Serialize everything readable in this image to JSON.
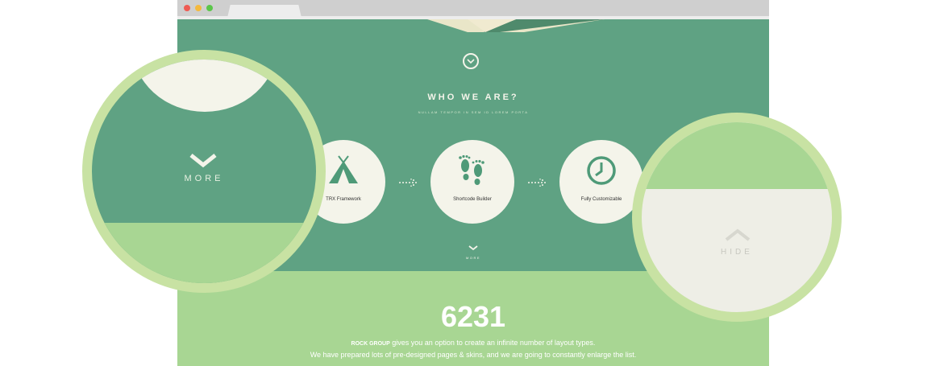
{
  "section": {
    "title": "WHO WE ARE?",
    "subtitle": "NULLAM TEMPOR IN SEM ID LOREM PORTA"
  },
  "features": [
    {
      "label": "TRX Framework",
      "icon": "tent-icon"
    },
    {
      "label": "Shortcode Builder",
      "icon": "footprints-icon"
    },
    {
      "label": "Fully Customizable",
      "icon": "clock-icon"
    }
  ],
  "more_small": "MORE",
  "stats": {
    "number": "6231",
    "brand": "ROCK GROUP",
    "line1": " gives you an option to create an infinite number of layout types.",
    "line2": "We have prepared lots of  pre-designed pages & skins, and we are going to constantly enlarge the list."
  },
  "magnifier_left": {
    "label": "MORE"
  },
  "magnifier_right": {
    "label": "HIDE"
  },
  "colors": {
    "primary_green": "#5fa283",
    "light_green": "#a8d693",
    "ring": "#c8e2a3",
    "cream": "#f4f4ea"
  }
}
